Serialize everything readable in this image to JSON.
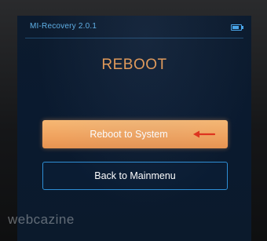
{
  "status_bar": {
    "app_title": "MI-Recovery 2.0.1",
    "battery_icon": "battery-icon"
  },
  "heading": "REBOOT",
  "buttons": {
    "reboot_to_system": "Reboot to System",
    "back_to_mainmenu": "Back to Mainmenu"
  },
  "annotation": {
    "arrow_icon": "left-arrow-icon",
    "arrow_color": "#e0321b"
  },
  "watermark": "webcazine",
  "colors": {
    "accent_orange": "#f0a25e",
    "accent_blue": "#2e8fd6",
    "title_blue": "#5fb0e6",
    "heading_orange": "#e89a52"
  }
}
